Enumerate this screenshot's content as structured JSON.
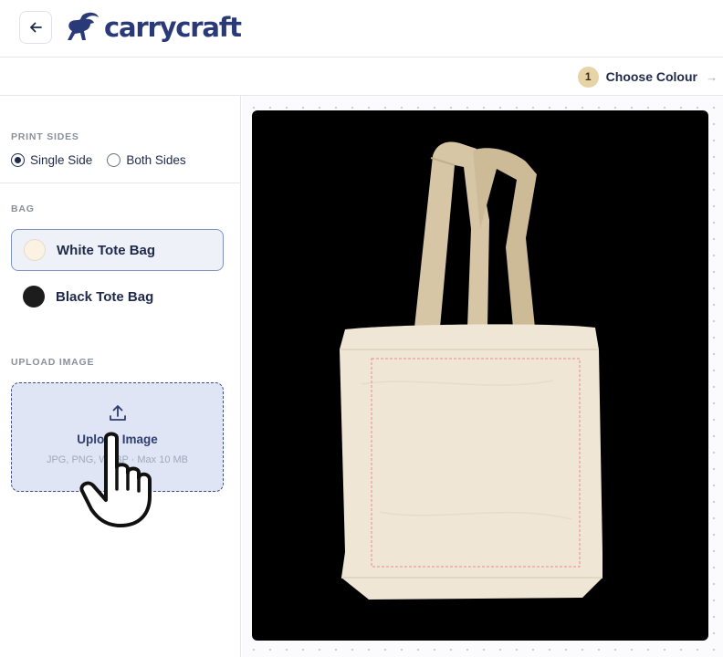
{
  "header": {
    "brand": "carrycraft",
    "back_icon": "arrow-left-icon"
  },
  "steps": [
    {
      "number": "1",
      "label": "Choose Colour",
      "arrow": "→"
    }
  ],
  "sidebar": {
    "print_sides": {
      "title": "PRINT SIDES",
      "options": [
        {
          "label": "Single Side",
          "selected": true
        },
        {
          "label": "Both Sides",
          "selected": false
        }
      ]
    },
    "bag": {
      "title": "BAG",
      "options": [
        {
          "label": "White Tote Bag",
          "color": "#fbf2e4",
          "selected": true
        },
        {
          "label": "Black Tote Bag",
          "color": "#1c1c1c",
          "selected": false
        }
      ]
    },
    "upload": {
      "title": "UPLOAD IMAGE",
      "button_label": "Upload Image",
      "hint": "JPG, PNG, WEBP · Max 10 MB",
      "icon": "upload-icon"
    }
  },
  "colors": {
    "brand": "#2a3a78",
    "accent_step": "#e6d3a6",
    "print_area_border": "#e88a8a",
    "bag_canvas": "#efe6d6",
    "strap": "#d7c6a6"
  }
}
